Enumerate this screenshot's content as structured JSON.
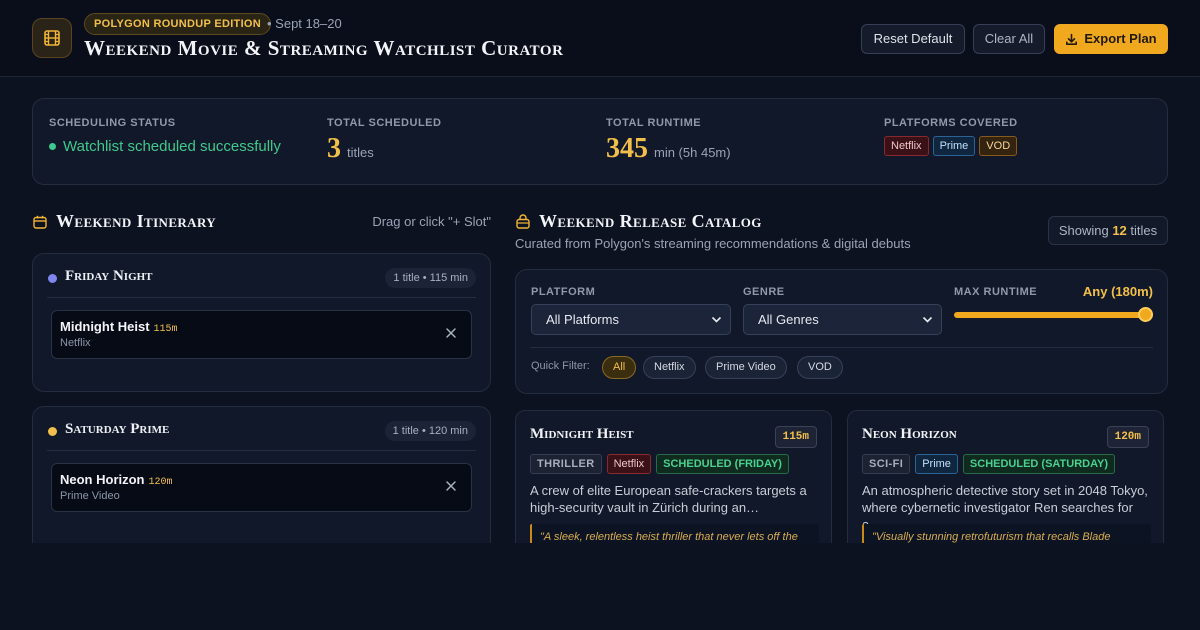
{
  "header": {
    "edition_badge": "POLYGON ROUNDUP EDITION",
    "dates": "• Sept 18–20",
    "title": "Weekend Movie & Streaming Watchlist Curator",
    "reset_label": "Reset Default",
    "clear_label": "Clear All",
    "export_label": "Export Plan"
  },
  "status": {
    "scheduling_label": "SCHEDULING STATUS",
    "scheduling_value": "Watchlist scheduled successfully",
    "scheduled_label": "TOTAL SCHEDULED",
    "scheduled_value": "3",
    "scheduled_unit": "titles",
    "runtime_label": "TOTAL RUNTIME",
    "runtime_value": "345",
    "runtime_unit": "min (5h 45m)",
    "platforms_label": "PLATFORMS COVERED",
    "platforms": [
      "Netflix",
      "Prime",
      "VOD"
    ]
  },
  "itinerary": {
    "title": "Weekend Itinerary",
    "hint": "Drag or click \"+ Slot\"",
    "days": [
      {
        "name": "Friday Night",
        "count": "1 title • 115 min",
        "dot_color": "#7f86ee",
        "slots": [
          {
            "title": "Midnight Heist",
            "runtime": "115m",
            "platform": "Netflix"
          }
        ]
      },
      {
        "name": "Saturday Prime",
        "count": "1 title • 120 min",
        "dot_color": "#f2c04a",
        "slots": [
          {
            "title": "Neon Horizon",
            "runtime": "120m",
            "platform": "Prime Video"
          }
        ]
      }
    ]
  },
  "catalog": {
    "title": "Weekend Release Catalog",
    "subtitle": "Curated from Polygon's streaming recommendations & digital debuts",
    "showing_prefix": "Showing",
    "showing_count": "12",
    "showing_suffix": "titles",
    "filters": {
      "platform_label": "PLATFORM",
      "platform_value": "All Platforms",
      "genre_label": "GENRE",
      "genre_value": "All Genres",
      "runtime_label": "MAX RUNTIME",
      "runtime_value": "Any (180m)",
      "runtime_level": 1.0,
      "quick_label": "Quick Filter:",
      "quick": [
        "All",
        "Netflix",
        "Prime Video",
        "VOD"
      ],
      "quick_active": "All"
    },
    "movies": [
      {
        "title": "Midnight Heist",
        "runtime": "115m",
        "genre": "THRILLER",
        "platform": "Netflix",
        "scheduled": "SCHEDULED (FRIDAY)",
        "desc": "A crew of elite European safe-crackers targets a high-security vault in Zürich during an…",
        "quote": "\"A sleek, relentless heist thriller that never lets off the"
      },
      {
        "title": "Neon Horizon",
        "runtime": "120m",
        "genre": "SCI-FI",
        "platform": "Prime",
        "scheduled": "SCHEDULED (SATURDAY)",
        "desc": "An atmospheric detective story set in 2048 Tokyo, where cybernetic investigator Ren searches for a…",
        "quote": "\"Visually stunning retrofuturism that recalls Blade"
      }
    ]
  },
  "colors": {
    "accent": "#f0a91f",
    "success": "#3fc98c",
    "background": "#0d1220"
  }
}
